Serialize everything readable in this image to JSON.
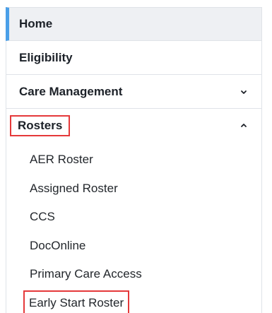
{
  "nav": {
    "home_label": "Home",
    "eligibility_label": "Eligibility",
    "care_management_label": "Care Management",
    "rosters_label": "Rosters",
    "rosters_submenu": [
      "AER Roster",
      "Assigned Roster",
      "CCS",
      "DocOnline",
      "Primary Care Access",
      "Early Start Roster"
    ]
  },
  "colors": {
    "active_accent": "#4a9fe8",
    "highlight_box": "#e5393a",
    "active_bg": "#eef0f3"
  },
  "icons": {
    "care_management": "chevron-down-icon",
    "rosters": "chevron-up-icon"
  }
}
